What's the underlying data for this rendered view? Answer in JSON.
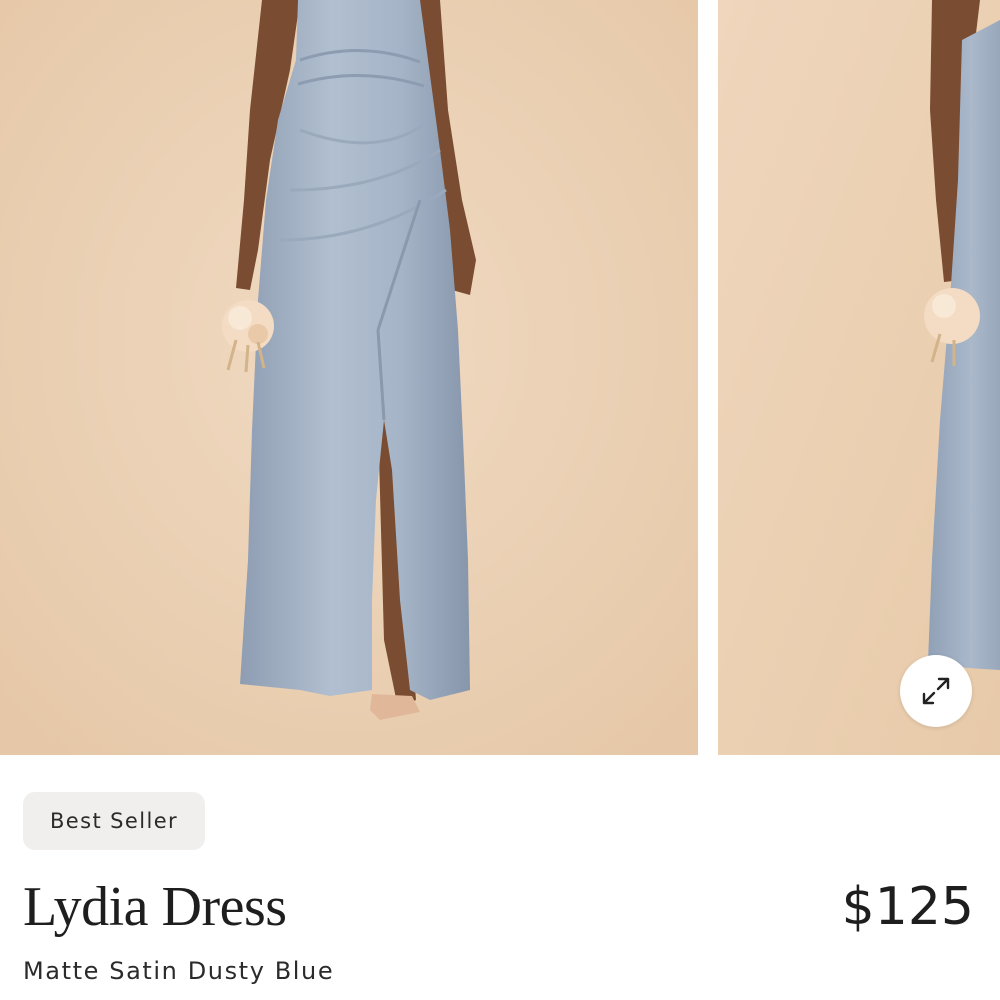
{
  "product": {
    "badge": "Best Seller",
    "name": "Lydia Dress",
    "price": "$125",
    "subtitle": "Matte Satin Dusty Blue"
  },
  "gallery": {
    "images": [
      {
        "subject": "dress-front-view"
      },
      {
        "subject": "dress-side-view"
      }
    ],
    "expand_icon": "expand-arrows-icon"
  },
  "colors": {
    "backdrop": "#ecd4b9",
    "dress": "#a3b2c6",
    "skin": "#8a5a3c",
    "page": "#ffffff",
    "badge_bg": "#f1efed",
    "text": "#1e1e1e"
  }
}
